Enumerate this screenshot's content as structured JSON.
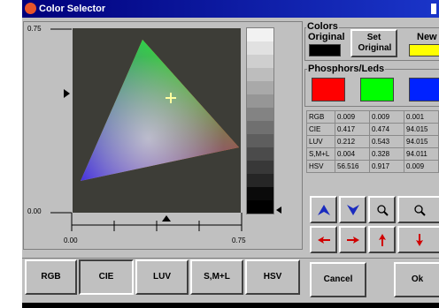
{
  "window": {
    "title": "Color Selector"
  },
  "plot": {
    "y_top": "0.75",
    "y_bottom": "0.00",
    "x_left": "0.00",
    "x_right": "0.75"
  },
  "grayscale": [
    "#f2f2f2",
    "#e1e1e1",
    "#cfcfcf",
    "#bdbdbd",
    "#a9a9a9",
    "#969696",
    "#838383",
    "#707070",
    "#5e5e5e",
    "#4b4b4b",
    "#383838",
    "#262626",
    "#0a0a0a",
    "#000000"
  ],
  "colors_group": {
    "title": "Colors",
    "original_label": "Original",
    "set_original_label": "Set Original",
    "new_label": "New",
    "original_color": "#000000",
    "new_color": "#ffff00"
  },
  "phosphors_group": {
    "title": "Phosphors/Leds",
    "swatches": [
      "#ff0000",
      "#00ff00",
      "#0022ff"
    ]
  },
  "table": [
    {
      "label": "RGB",
      "v1": "0.009",
      "v2": "0.009",
      "v3": "0.001"
    },
    {
      "label": "CIE",
      "v1": "0.417",
      "v2": "0.474",
      "v3": "94.015"
    },
    {
      "label": "LUV",
      "v1": "0.212",
      "v2": "0.543",
      "v3": "94.015"
    },
    {
      "label": "S,M+L",
      "v1": "0.004",
      "v2": "0.328",
      "v3": "94.011"
    },
    {
      "label": "HSV",
      "v1": "56.516",
      "v2": "0.917",
      "v3": "0.009"
    }
  ],
  "tabs": {
    "rgb": "RGB",
    "cie": "CIE",
    "luv": "LUV",
    "sml": "S,M+L",
    "hsv": "HSV"
  },
  "buttons": {
    "cancel": "Cancel",
    "ok": "Ok"
  }
}
